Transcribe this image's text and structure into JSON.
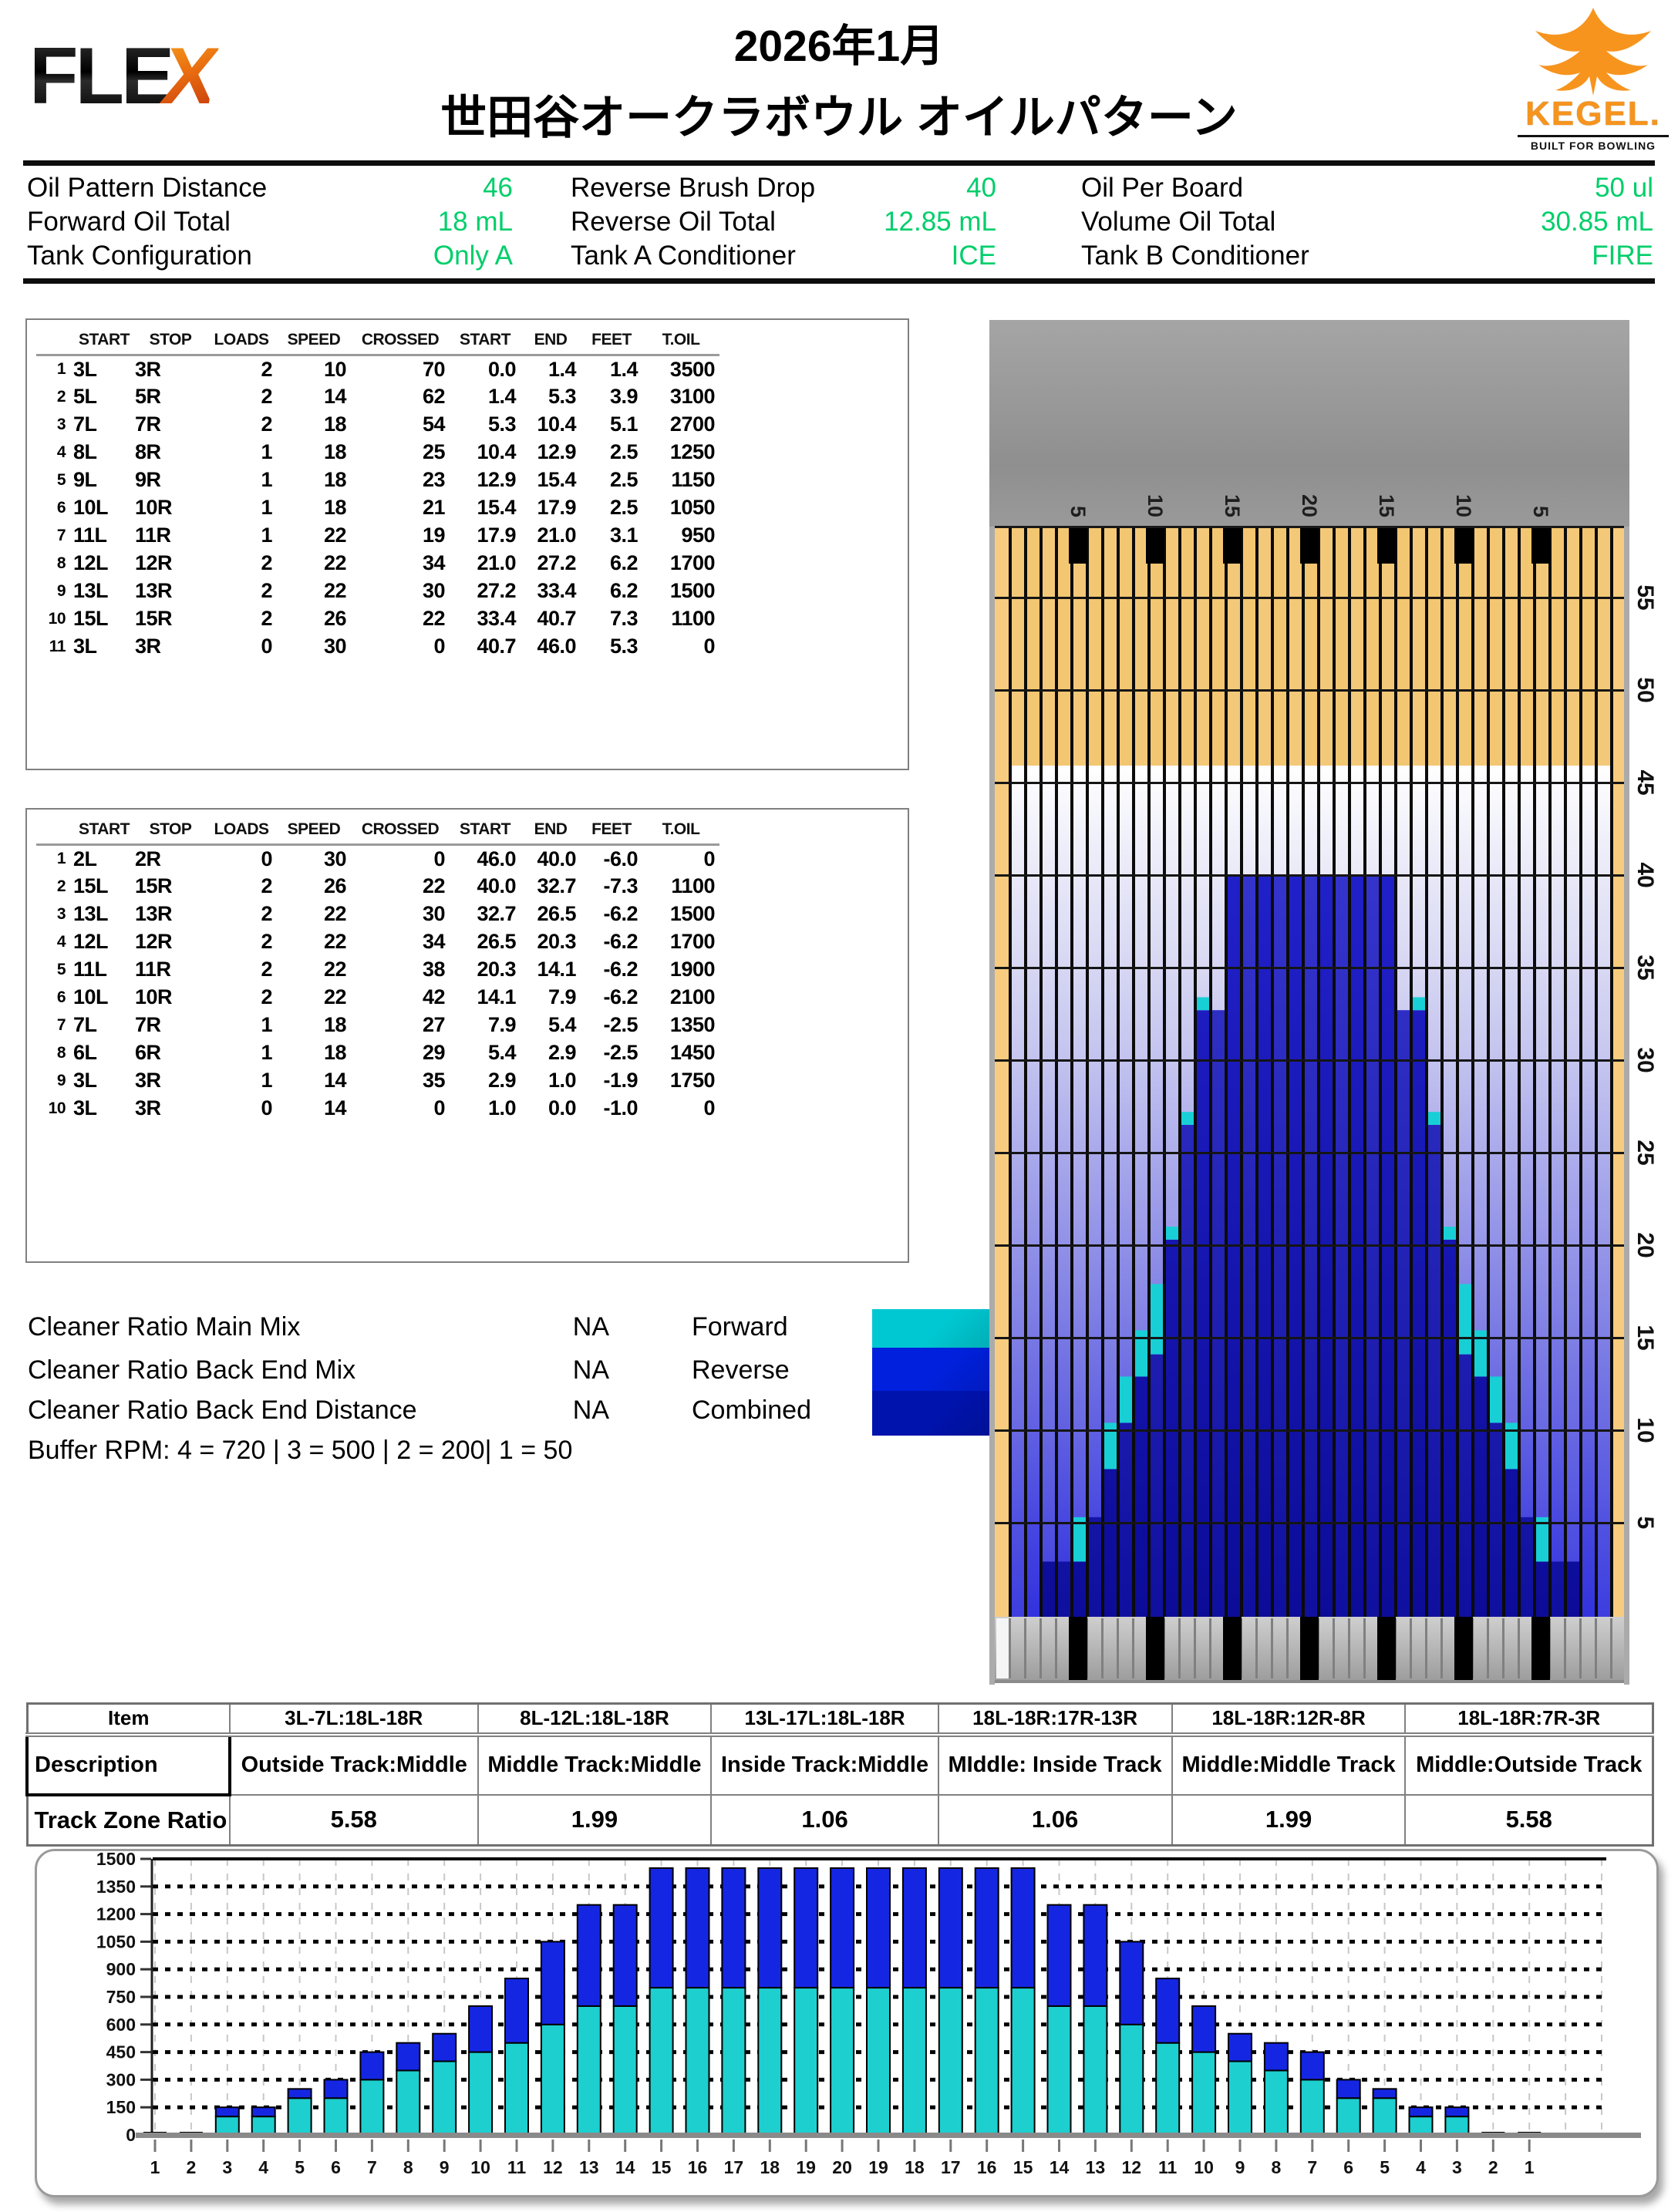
{
  "header": {
    "title_line1": "2026年1月",
    "title_line2": "世田谷オークラボウル オイルパターン",
    "flex_logo_fle": "FLE",
    "flex_logo_x": "X",
    "kegel_logo_text": "KEGEL.",
    "kegel_tagline": "BUILT FOR BOWLING"
  },
  "info_table": {
    "value_color": "#00CE6B",
    "cells": [
      [
        {
          "label": "Oil Pattern Distance",
          "value": "46"
        },
        {
          "label": "Reverse Brush Drop",
          "value": "40"
        },
        {
          "label": "Oil Per Board",
          "value": "50 ul"
        }
      ],
      [
        {
          "label": "Forward Oil Total",
          "value": "18 mL"
        },
        {
          "label": "Reverse Oil Total",
          "value": "12.85 mL"
        },
        {
          "label": "Volume Oil Total",
          "value": "30.85 mL"
        }
      ],
      [
        {
          "label": "Tank Configuration",
          "value": "Only A"
        },
        {
          "label": "Tank A Conditioner",
          "value": "ICE"
        },
        {
          "label": "Tank B Conditioner",
          "value": "FIRE"
        }
      ]
    ]
  },
  "forward_table": {
    "headers": [
      "",
      "START",
      "STOP",
      "LOADS",
      "SPEED",
      "CROSSED",
      "START",
      "END",
      "FEET",
      "T.OIL"
    ],
    "rows": [
      [
        "1",
        "3L",
        "3R",
        "2",
        "10",
        "70",
        "0.0",
        "1.4",
        "1.4",
        "3500"
      ],
      [
        "2",
        "5L",
        "5R",
        "2",
        "14",
        "62",
        "1.4",
        "5.3",
        "3.9",
        "3100"
      ],
      [
        "3",
        "7L",
        "7R",
        "2",
        "18",
        "54",
        "5.3",
        "10.4",
        "5.1",
        "2700"
      ],
      [
        "4",
        "8L",
        "8R",
        "1",
        "18",
        "25",
        "10.4",
        "12.9",
        "2.5",
        "1250"
      ],
      [
        "5",
        "9L",
        "9R",
        "1",
        "18",
        "23",
        "12.9",
        "15.4",
        "2.5",
        "1150"
      ],
      [
        "6",
        "10L",
        "10R",
        "1",
        "18",
        "21",
        "15.4",
        "17.9",
        "2.5",
        "1050"
      ],
      [
        "7",
        "11L",
        "11R",
        "1",
        "22",
        "19",
        "17.9",
        "21.0",
        "3.1",
        "950"
      ],
      [
        "8",
        "12L",
        "12R",
        "2",
        "22",
        "34",
        "21.0",
        "27.2",
        "6.2",
        "1700"
      ],
      [
        "9",
        "13L",
        "13R",
        "2",
        "22",
        "30",
        "27.2",
        "33.4",
        "6.2",
        "1500"
      ],
      [
        "10",
        "15L",
        "15R",
        "2",
        "26",
        "22",
        "33.4",
        "40.7",
        "7.3",
        "1100"
      ],
      [
        "11",
        "3L",
        "3R",
        "0",
        "30",
        "0",
        "40.7",
        "46.0",
        "5.3",
        "0"
      ]
    ]
  },
  "reverse_table": {
    "headers": [
      "",
      "START",
      "STOP",
      "LOADS",
      "SPEED",
      "CROSSED",
      "START",
      "END",
      "FEET",
      "T.OIL"
    ],
    "rows": [
      [
        "1",
        "2L",
        "2R",
        "0",
        "30",
        "0",
        "46.0",
        "40.0",
        "-6.0",
        "0"
      ],
      [
        "2",
        "15L",
        "15R",
        "2",
        "26",
        "22",
        "40.0",
        "32.7",
        "-7.3",
        "1100"
      ],
      [
        "3",
        "13L",
        "13R",
        "2",
        "22",
        "30",
        "32.7",
        "26.5",
        "-6.2",
        "1500"
      ],
      [
        "4",
        "12L",
        "12R",
        "2",
        "22",
        "34",
        "26.5",
        "20.3",
        "-6.2",
        "1700"
      ],
      [
        "5",
        "11L",
        "11R",
        "2",
        "22",
        "38",
        "20.3",
        "14.1",
        "-6.2",
        "1900"
      ],
      [
        "6",
        "10L",
        "10R",
        "2",
        "22",
        "42",
        "14.1",
        "7.9",
        "-6.2",
        "2100"
      ],
      [
        "7",
        "7L",
        "7R",
        "1",
        "18",
        "27",
        "7.9",
        "5.4",
        "-2.5",
        "1350"
      ],
      [
        "8",
        "6L",
        "6R",
        "1",
        "18",
        "29",
        "5.4",
        "2.9",
        "-2.5",
        "1450"
      ],
      [
        "9",
        "3L",
        "3R",
        "1",
        "14",
        "35",
        "2.9",
        "1.0",
        "-1.9",
        "1750"
      ],
      [
        "10",
        "3L",
        "3R",
        "0",
        "14",
        "0",
        "1.0",
        "0.0",
        "-1.0",
        "0"
      ]
    ]
  },
  "cleaner": {
    "rows": [
      {
        "label": "Cleaner Ratio Main Mix",
        "value": "NA"
      },
      {
        "label": "Cleaner Ratio Back End Mix",
        "value": "NA"
      },
      {
        "label": "Cleaner Ratio Back End Distance",
        "value": "NA"
      }
    ],
    "buffer_rpm_line": "Buffer RPM: 4 = 720 | 3 = 500 | 2 = 200| 1 = 50",
    "legend": [
      {
        "label": "Forward",
        "color": "#00C8D2"
      },
      {
        "label": "Reverse",
        "color": "#0020DD"
      },
      {
        "label": "Combined",
        "color": "#0013AD"
      }
    ]
  },
  "zone_table": {
    "item_row": [
      "Item",
      "3L-7L:18L-18R",
      "8L-12L:18L-18R",
      "13L-17L:18L-18R",
      "18L-18R:17R-13R",
      "18L-18R:12R-8R",
      "18L-18R:7R-3R"
    ],
    "description_row": [
      "Description",
      "Outside Track:Middle",
      "Middle Track:Middle",
      "Inside Track:Middle",
      "MIddle: Inside Track",
      "Middle:Middle Track",
      "Middle:Outside Track"
    ],
    "ratio_row": [
      "Track Zone Ratio",
      "5.58",
      "1.99",
      "1.06",
      "1.06",
      "1.99",
      "5.58"
    ]
  },
  "chart_data": [
    {
      "name": "lane-oil-pattern-map",
      "type": "heatmap",
      "orientation": "top-down lane view, foul line (0 ft) at bottom, pins at top",
      "boards_total": 39,
      "oil_pattern_distance_ft": 46,
      "buff_only_zone_ft": [
        40,
        46
      ],
      "distance_tick_labels": [
        5,
        10,
        15,
        20,
        25,
        30,
        35,
        40,
        45,
        50,
        55
      ],
      "board_tick_labels": [
        {
          "board": 5,
          "label": "5"
        },
        {
          "board": 10,
          "label": "10"
        },
        {
          "board": 15,
          "label": "15"
        },
        {
          "board": 20,
          "label": "20"
        },
        {
          "board": 25,
          "label": "15"
        },
        {
          "board": 30,
          "label": "10"
        },
        {
          "board": 35,
          "label": "5"
        }
      ],
      "combined_oil_to_ft": [
        0,
        0,
        2.9,
        2.9,
        2.9,
        5.3,
        7.9,
        10.4,
        12.9,
        14.1,
        20.3,
        26.5,
        32.7,
        32.7,
        40,
        40,
        40,
        40,
        40,
        40,
        40,
        40,
        40,
        40,
        40,
        32.7,
        32.7,
        26.5,
        20.3,
        14.1,
        12.9,
        10.4,
        7.9,
        5.3,
        2.9,
        2.9,
        2.9,
        0,
        0
      ],
      "forward_tips": [
        {
          "board": 5,
          "from_ft": 2.9,
          "to_ft": 5.3
        },
        {
          "board": 7,
          "from_ft": 7.9,
          "to_ft": 10.4
        },
        {
          "board": 8,
          "from_ft": 10.4,
          "to_ft": 12.9
        },
        {
          "board": 9,
          "from_ft": 12.9,
          "to_ft": 15.4
        },
        {
          "board": 10,
          "from_ft": 14.1,
          "to_ft": 17.9
        },
        {
          "board": 11,
          "from_ft": 20.3,
          "to_ft": 21.0
        },
        {
          "board": 12,
          "from_ft": 26.5,
          "to_ft": 27.2
        },
        {
          "board": 13,
          "from_ft": 32.7,
          "to_ft": 33.4
        },
        {
          "board": 27,
          "from_ft": 32.7,
          "to_ft": 33.4
        },
        {
          "board": 28,
          "from_ft": 26.5,
          "to_ft": 27.2
        },
        {
          "board": 29,
          "from_ft": 20.3,
          "to_ft": 21.0
        },
        {
          "board": 30,
          "from_ft": 14.1,
          "to_ft": 17.9
        },
        {
          "board": 31,
          "from_ft": 12.9,
          "to_ft": 15.4
        },
        {
          "board": 32,
          "from_ft": 10.4,
          "to_ft": 12.9
        },
        {
          "board": 33,
          "from_ft": 7.9,
          "to_ft": 10.4
        },
        {
          "board": 35,
          "from_ft": 2.9,
          "to_ft": 5.3
        }
      ],
      "colors": {
        "wood": "#F3C671",
        "gutter": "#F8CC7E",
        "pin_deck": "#9A9A9A",
        "combined_dark_top": "#2323CF",
        "combined_dark_bottom": "#0C0C98",
        "forward_tip": "#19CFD6",
        "oil_film_top": "#FFFFFF",
        "oil_film_bottom": "#3232DE",
        "marker": "#000000"
      }
    },
    {
      "name": "oil-per-board",
      "type": "bar",
      "stacked": true,
      "categories": [
        "1",
        "2",
        "3",
        "4",
        "5",
        "6",
        "7",
        "8",
        "9",
        "10",
        "11",
        "12",
        "13",
        "14",
        "15",
        "16",
        "17",
        "18",
        "19",
        "20",
        "19",
        "18",
        "17",
        "16",
        "15",
        "14",
        "13",
        "12",
        "11",
        "10",
        "9",
        "8",
        "7",
        "6",
        "5",
        "4",
        "3",
        "2",
        "1"
      ],
      "series": [
        {
          "name": "Forward",
          "color": "#1ECFCF",
          "values": [
            0,
            0,
            100,
            100,
            200,
            200,
            300,
            350,
            400,
            450,
            500,
            600,
            700,
            700,
            800,
            800,
            800,
            800,
            800,
            800,
            800,
            800,
            800,
            800,
            800,
            700,
            700,
            600,
            500,
            450,
            400,
            350,
            300,
            200,
            200,
            100,
            100,
            0,
            0
          ]
        },
        {
          "name": "Reverse",
          "color": "#1526E3",
          "values": [
            0,
            0,
            50,
            50,
            50,
            100,
            150,
            150,
            150,
            250,
            350,
            450,
            550,
            550,
            650,
            650,
            650,
            650,
            650,
            650,
            650,
            650,
            650,
            650,
            650,
            550,
            550,
            450,
            350,
            250,
            150,
            150,
            150,
            100,
            50,
            50,
            50,
            0,
            0
          ]
        }
      ],
      "ylim": [
        0,
        1500
      ],
      "yticks": [
        0,
        150,
        300,
        450,
        600,
        750,
        900,
        1050,
        1200,
        1350,
        1500
      ],
      "grid": true,
      "legend_position": "none"
    }
  ]
}
